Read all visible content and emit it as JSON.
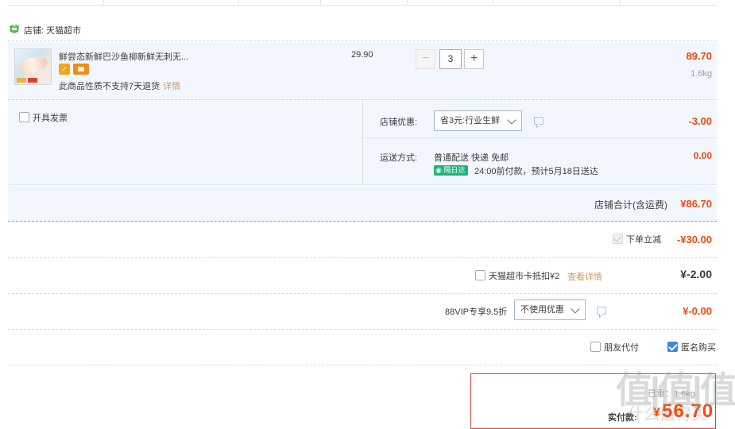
{
  "shop": {
    "label": "店铺: 天猫超市"
  },
  "item": {
    "title": "鲜尝态新鲜巴沙鱼柳新鲜无刺无...",
    "note": "此商品性质不支持7天退货",
    "note_link": "详情",
    "unit_price": "29.90",
    "quantity": "3",
    "minus": "−",
    "plus": "+",
    "subtotal": "89.70",
    "weight": "1.6kg"
  },
  "options": {
    "invoice_label": "开具发票",
    "discount_label": "店铺优惠:",
    "discount_select": "省3元:行业生鲜",
    "discount_amount": "-3.00",
    "ship_label": "运送方式:",
    "ship_method": "普通配送 快递 免邮",
    "ship_badge": "隔日达",
    "ship_time": "24:00前付款，预计5月18日送达",
    "ship_fee": "0.00"
  },
  "shop_total": {
    "label": "店铺合计(含运费)",
    "value": "¥86.70"
  },
  "instant_discount": {
    "label": "下单立减",
    "value": "-¥30.00"
  },
  "card": {
    "label": "天猫超市卡抵扣¥2",
    "link": "查看详情",
    "value": "¥-2.00"
  },
  "vip": {
    "label": "88VIP专享9.5折",
    "select": "不使用优惠",
    "value": "¥-0.00"
  },
  "extras": {
    "friend_pay": "朋友代付",
    "anonymous": "匿名购买"
  },
  "pay": {
    "line1": "已重：1.6kg",
    "label": "实付款:",
    "symbol": "¥",
    "value": "56.70"
  },
  "watermark": {
    "main": "值|值|值",
    "sub": "什么值得买"
  }
}
